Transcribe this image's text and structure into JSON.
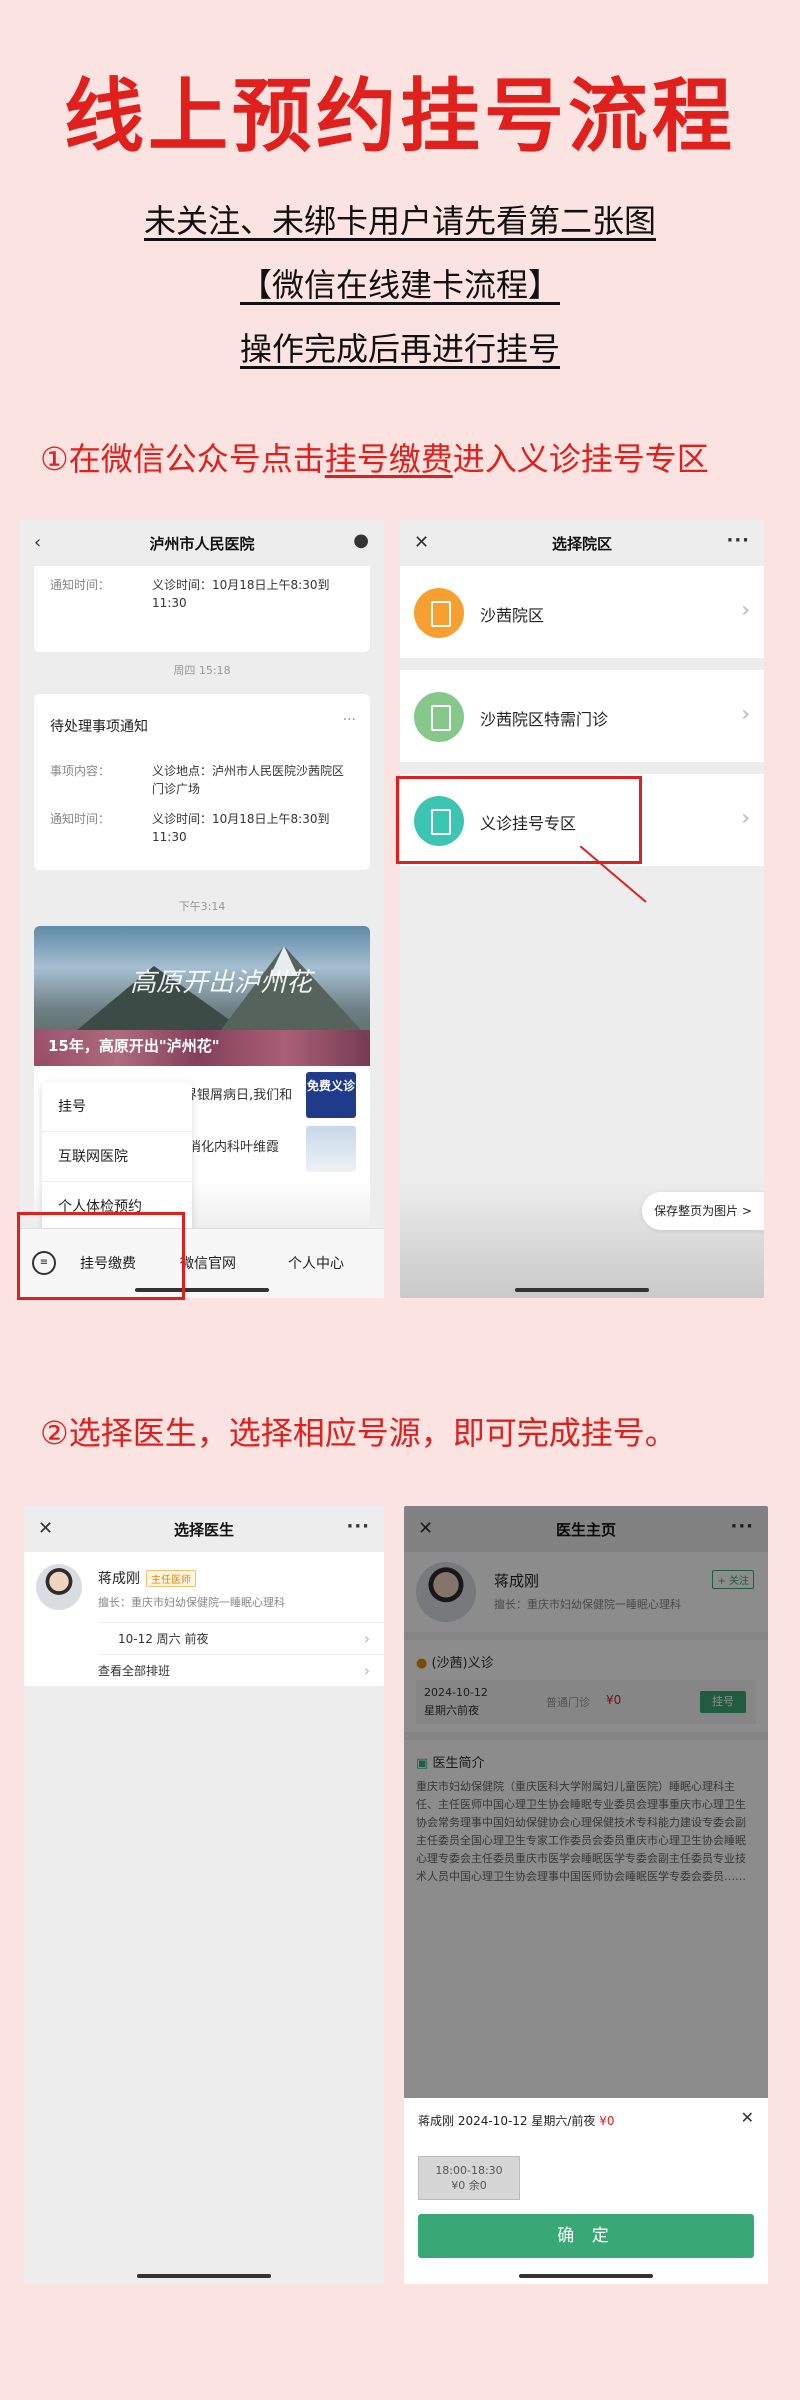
{
  "title": "线上预约挂号流程",
  "intro": [
    "未关注、未绑卡用户请先看第二张图",
    "【微信在线建卡流程】",
    "操作完成后再进行挂号"
  ],
  "step1": {
    "prefix": "①在微信公众号点击",
    "link": "挂号缴费",
    "suffix": "进入义诊挂号专区"
  },
  "step2": "②选择医生，选择相应号源，即可完成挂号。",
  "phone1": {
    "header": "泸州市人民医院",
    "card1": {
      "label": "通知时间：",
      "value": "义诊时间：10月18日上午8:30到11:30"
    },
    "ts1": "周四 15:18",
    "card2": {
      "title": "待处理事项通知",
      "more": "···",
      "rows": [
        {
          "label": "事项内容：",
          "value": "义诊地点：泸州市人民医院沙茜院区门诊广场"
        },
        {
          "label": "通知时间：",
          "value": "义诊时间：10月18日上午8:30到11:30"
        }
      ]
    },
    "ts2": "下午3:14",
    "banner_brush": "高原开出泸州花",
    "banner_caption": "15年，高原开出\"泸州花\"",
    "news": [
      "界银屑病日,我们和",
      "消化内科叶维霞"
    ],
    "thumb_text": "免费义诊",
    "menu": [
      "挂号",
      "互联网医院",
      "个人体检预约"
    ],
    "tabs": [
      "挂号缴费",
      "微信官网",
      "个人中心"
    ]
  },
  "phone2": {
    "header": "选择院区",
    "campuses": [
      "沙茜院区",
      "沙茜院区特需门诊",
      "义诊挂号专区"
    ],
    "colors": [
      "#f5a030",
      "#86c78a",
      "#3cc6b1"
    ],
    "save": "保存整页为图片 >"
  },
  "phone3": {
    "header": "选择医生",
    "doctor": "蒋成刚",
    "badge": "主任医师",
    "desc": "擅长：重庆市妇幼保健院一睡眠心理科",
    "slot": "10-12 周六 前夜",
    "all": "查看全部排班"
  },
  "phone4": {
    "header": "医生主页",
    "doctor": "蒋成刚",
    "follow": "+ 关注",
    "desc": "擅长：重庆市妇幼保健院一睡眠心理科",
    "section1": "(沙茜)义诊",
    "date": "2024-10-12",
    "weekday": "星期六前夜",
    "type": "普通门诊",
    "price": "¥0",
    "reg": "挂号",
    "section2": "医生简介",
    "bio": "重庆市妇幼保健院（重庆医科大学附属妇儿童医院）睡眠心理科主任、主任医师中国心理卫生协会睡眠专业委员会理事重庆市心理卫生协会常务理事中国妇幼保健协会心理保健技术专科能力建设专委会副主任委员全国心理卫生专家工作委员会委员重庆市心理卫生协会睡眠心理专委会主任委员重庆市医学会睡眠医学专委会副主任委员专业技术人员中国心理卫生协会理事中国医师协会睡眠医学专委会委员……",
    "sheet_title": "蒋成刚 2024-10-12 星期六/前夜",
    "sheet_price": "¥0",
    "slot_time": "18:00-18:30",
    "slot_remain": "¥0 余0",
    "confirm": "确 定"
  }
}
